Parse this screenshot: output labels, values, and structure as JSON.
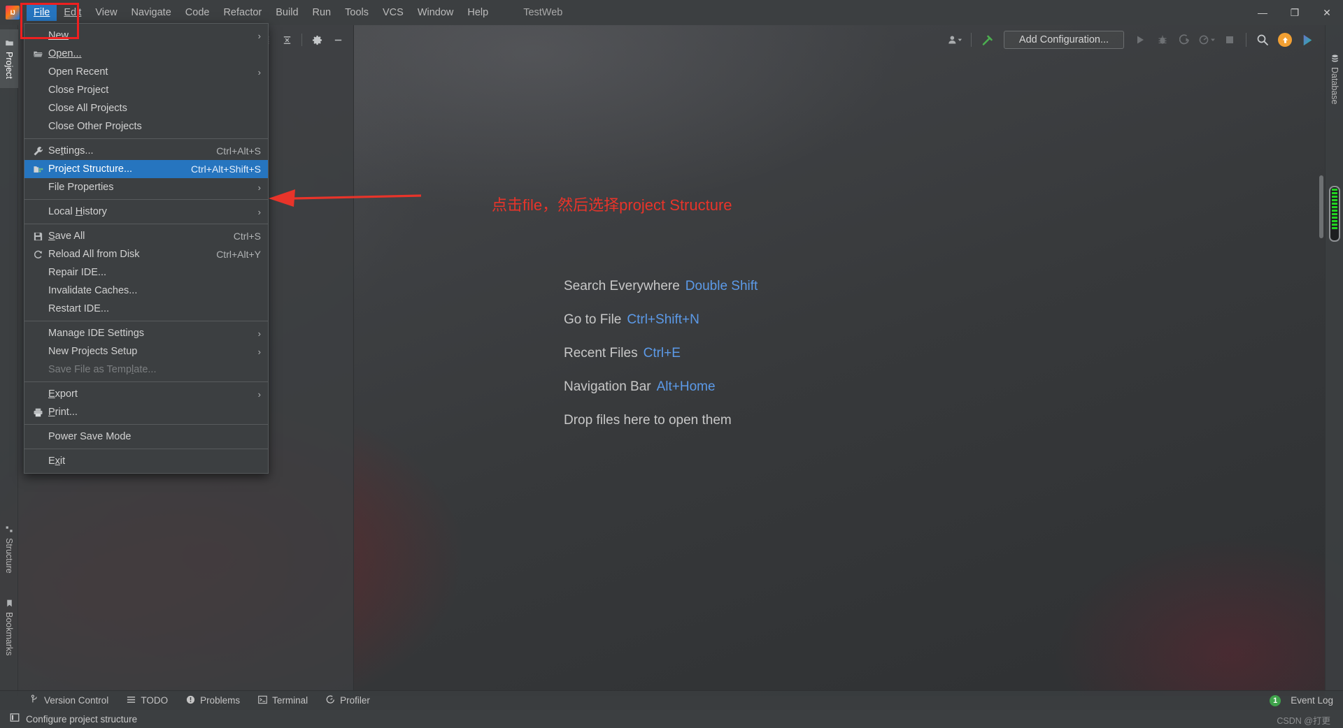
{
  "window": {
    "title": "TestWeb",
    "logo": "intellij-idea-logo",
    "controls": {
      "minimize": "—",
      "maximize": "❐",
      "close": "✕"
    }
  },
  "menubar": {
    "items": [
      {
        "label": "File",
        "mnemonic": "F",
        "active": true
      },
      {
        "label": "Edit",
        "mnemonic": "E",
        "active": false
      },
      {
        "label": "View",
        "mnemonic": "V",
        "active": false
      },
      {
        "label": "Navigate",
        "mnemonic": "N",
        "active": false
      },
      {
        "label": "Code",
        "mnemonic": "C",
        "active": false
      },
      {
        "label": "Refactor",
        "mnemonic": "R",
        "active": false
      },
      {
        "label": "Build",
        "mnemonic": "B",
        "active": false
      },
      {
        "label": "Run",
        "mnemonic": "u",
        "active": false
      },
      {
        "label": "Tools",
        "mnemonic": "T",
        "active": false
      },
      {
        "label": "VCS",
        "mnemonic": "S",
        "active": false
      },
      {
        "label": "Window",
        "mnemonic": "W",
        "active": false
      },
      {
        "label": "Help",
        "mnemonic": "H",
        "active": false
      }
    ]
  },
  "file_menu": {
    "groups": [
      {
        "items": [
          {
            "label": "New",
            "icon": "",
            "shortcut": "",
            "submenu": true,
            "selected": false,
            "disabled": false
          },
          {
            "label": "Open...",
            "icon": "folder-open-icon",
            "shortcut": "",
            "submenu": false,
            "selected": false,
            "disabled": false
          },
          {
            "label": "Open Recent",
            "icon": "",
            "shortcut": "",
            "submenu": true,
            "selected": false,
            "disabled": false
          },
          {
            "label": "Close Project",
            "icon": "",
            "shortcut": "",
            "submenu": false,
            "selected": false,
            "disabled": false
          },
          {
            "label": "Close All Projects",
            "icon": "",
            "shortcut": "",
            "submenu": false,
            "selected": false,
            "disabled": false
          },
          {
            "label": "Close Other Projects",
            "icon": "",
            "shortcut": "",
            "submenu": false,
            "selected": false,
            "disabled": false
          }
        ]
      },
      {
        "items": [
          {
            "label": "Settings...",
            "icon": "wrench-icon",
            "shortcut": "Ctrl+Alt+S",
            "submenu": false,
            "selected": false,
            "disabled": false
          },
          {
            "label": "Project Structure...",
            "icon": "project-structure-icon",
            "shortcut": "Ctrl+Alt+Shift+S",
            "submenu": false,
            "selected": true,
            "disabled": false
          },
          {
            "label": "File Properties",
            "icon": "",
            "shortcut": "",
            "submenu": true,
            "selected": false,
            "disabled": false
          }
        ]
      },
      {
        "items": [
          {
            "label": "Local History",
            "icon": "",
            "shortcut": "",
            "submenu": true,
            "selected": false,
            "disabled": false
          }
        ]
      },
      {
        "items": [
          {
            "label": "Save All",
            "icon": "save-icon",
            "shortcut": "Ctrl+S",
            "submenu": false,
            "selected": false,
            "disabled": false
          },
          {
            "label": "Reload All from Disk",
            "icon": "reload-icon",
            "shortcut": "Ctrl+Alt+Y",
            "submenu": false,
            "selected": false,
            "disabled": false
          },
          {
            "label": "Repair IDE...",
            "icon": "",
            "shortcut": "",
            "submenu": false,
            "selected": false,
            "disabled": false
          },
          {
            "label": "Invalidate Caches...",
            "icon": "",
            "shortcut": "",
            "submenu": false,
            "selected": false,
            "disabled": false
          },
          {
            "label": "Restart IDE...",
            "icon": "",
            "shortcut": "",
            "submenu": false,
            "selected": false,
            "disabled": false
          }
        ]
      },
      {
        "items": [
          {
            "label": "Manage IDE Settings",
            "icon": "",
            "shortcut": "",
            "submenu": true,
            "selected": false,
            "disabled": false
          },
          {
            "label": "New Projects Setup",
            "icon": "",
            "shortcut": "",
            "submenu": true,
            "selected": false,
            "disabled": false
          },
          {
            "label": "Save File as Template...",
            "icon": "",
            "shortcut": "",
            "submenu": false,
            "selected": false,
            "disabled": true
          }
        ]
      },
      {
        "items": [
          {
            "label": "Export",
            "icon": "",
            "shortcut": "",
            "submenu": true,
            "selected": false,
            "disabled": false
          },
          {
            "label": "Print...",
            "icon": "printer-icon",
            "shortcut": "",
            "submenu": false,
            "selected": false,
            "disabled": false
          }
        ]
      },
      {
        "items": [
          {
            "label": "Power Save Mode",
            "icon": "",
            "shortcut": "",
            "submenu": false,
            "selected": false,
            "disabled": false
          }
        ]
      },
      {
        "items": [
          {
            "label": "Exit",
            "icon": "",
            "shortcut": "",
            "submenu": false,
            "selected": false,
            "disabled": false
          }
        ]
      }
    ]
  },
  "toolbar": {
    "add_configuration": "Add Configuration...",
    "icons": [
      "user-dropdown-icon",
      "hammer-icon",
      "run-icon",
      "debug-icon",
      "run-with-coverage-icon",
      "profile-dropdown-icon",
      "stop-icon",
      "search-icon",
      "update-icon",
      "idea-feature-icon"
    ]
  },
  "left_tool_window": {
    "tabs": [
      {
        "label": "Project",
        "icon": "project-folder-icon",
        "selected": true
      },
      {
        "label": "Structure",
        "icon": "structure-icon",
        "selected": false
      },
      {
        "label": "Bookmarks",
        "icon": "bookmark-icon",
        "selected": false
      }
    ],
    "panel_buttons": [
      "collapse-all-icon",
      "expand-all-icon",
      "settings-gear-icon",
      "hide-icon"
    ]
  },
  "right_tool_window": {
    "tabs": [
      {
        "label": "Database",
        "icon": "database-icon",
        "selected": false
      }
    ],
    "memory_indicator": "memory-gauge"
  },
  "editor": {
    "annotation": "点击file，然后选择project Structure",
    "annotation_color": "#e8342a",
    "tips": [
      {
        "action": "Search Everywhere",
        "shortcut": "Double Shift"
      },
      {
        "action": "Go to File",
        "shortcut": "Ctrl+Shift+N"
      },
      {
        "action": "Recent Files",
        "shortcut": "Ctrl+E"
      },
      {
        "action": "Navigation Bar",
        "shortcut": "Alt+Home"
      },
      {
        "action": "Drop files here to open them",
        "shortcut": ""
      }
    ],
    "tip_key_color": "#5c9ae8"
  },
  "bottom_bar": {
    "items": [
      {
        "label": "Version Control",
        "icon": "branch-icon"
      },
      {
        "label": "TODO",
        "icon": "list-icon"
      },
      {
        "label": "Problems",
        "icon": "exclamation-circle-icon"
      },
      {
        "label": "Terminal",
        "icon": "terminal-icon"
      },
      {
        "label": "Profiler",
        "icon": "profiler-icon"
      }
    ],
    "event_log": {
      "label": "Event Log",
      "count": "1",
      "badge_color": "#3fa34b"
    }
  },
  "status_bar": {
    "icon": "widget-icon",
    "text": "Configure project structure"
  },
  "watermark": "CSDN @打更",
  "highlight": {
    "box_color": "#ee2020",
    "arrow_color": "#e8342a",
    "selection_color": "#2675bf"
  }
}
